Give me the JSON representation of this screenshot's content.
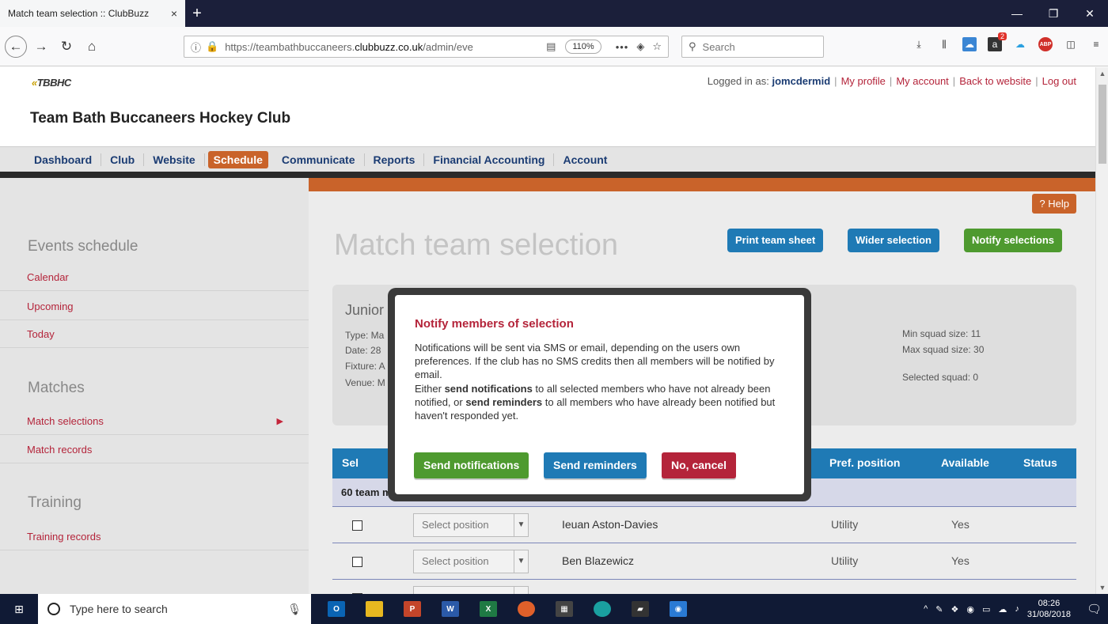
{
  "browser": {
    "tab_title": "Match team selection :: ClubBuzz",
    "tab_close": "×",
    "new_tab": "+",
    "url_domain": "https://teambathbuccaneers.",
    "url_bold": "clubbuzz.co.uk",
    "url_rest": "/admin/eve",
    "zoom": "110%",
    "search_placeholder": "Search"
  },
  "header": {
    "logo": "TBBHC",
    "club_name": "Team Bath Buccaneers Hockey Club",
    "logged_in_label": "Logged in as: ",
    "username": "jomcdermid",
    "links": [
      "My profile",
      "My account",
      "Back to website",
      "Log out"
    ]
  },
  "nav": {
    "items": [
      "Dashboard",
      "Club",
      "Website",
      "Schedule",
      "Communicate",
      "Reports",
      "Financial Accounting",
      "Account"
    ],
    "active": "Schedule"
  },
  "sidebar": {
    "events_heading": "Events schedule",
    "events_items": [
      "Calendar",
      "Upcoming",
      "Today"
    ],
    "matches_heading": "Matches",
    "matches_items": [
      "Match selections",
      "Match records"
    ],
    "training_heading": "Training",
    "training_items": [
      "Training records"
    ]
  },
  "content": {
    "help": "? Help",
    "title": "Match team selection",
    "buttons": {
      "print": "Print team sheet",
      "wider": "Wider selection",
      "notify": "Notify selections"
    },
    "card": {
      "heading": "Junior",
      "type": "Type: Ma",
      "date": "Date: 28",
      "fixture": "Fixture: A",
      "venue": "Venue: M",
      "min_squad": "Min squad size: 11",
      "max_squad": "Max squad size: 30",
      "selected": "Selected squad: 0"
    },
    "table": {
      "headers": {
        "sel": "Sel",
        "pref": "Pref. position",
        "available": "Available",
        "status": "Status"
      },
      "group": "60 team m",
      "rows": [
        {
          "position": "Select position",
          "name": "Ieuan Aston-Davies",
          "pref": "Utility",
          "available": "Yes"
        },
        {
          "position": "Select position",
          "name": "Ben Blazewicz",
          "pref": "Utility",
          "available": "Yes"
        }
      ]
    }
  },
  "modal": {
    "title": "Notify members of selection",
    "para1": "Notifications will be sent via SMS or email, depending on the users own preferences. If the club has no SMS credits then all members will be notified by email.",
    "para2_a": "Either ",
    "para2_b": "send notifications",
    "para2_c": " to all selected members who have not already been notified, or ",
    "para2_d": "send reminders",
    "para2_e": " to all members who have already been notified but haven't responded yet.",
    "send_notifications": "Send notifications",
    "send_reminders": "Send reminders",
    "cancel": "No, cancel"
  },
  "taskbar": {
    "search_placeholder": "Type here to search",
    "time": "08:26",
    "date": "31/08/2018"
  },
  "colors": {
    "accent_orange": "#c9632a",
    "link_red": "#b4243a",
    "button_blue": "#1f7ab5",
    "button_green": "#4e9a2f",
    "nav_blue": "#1b3c73"
  }
}
